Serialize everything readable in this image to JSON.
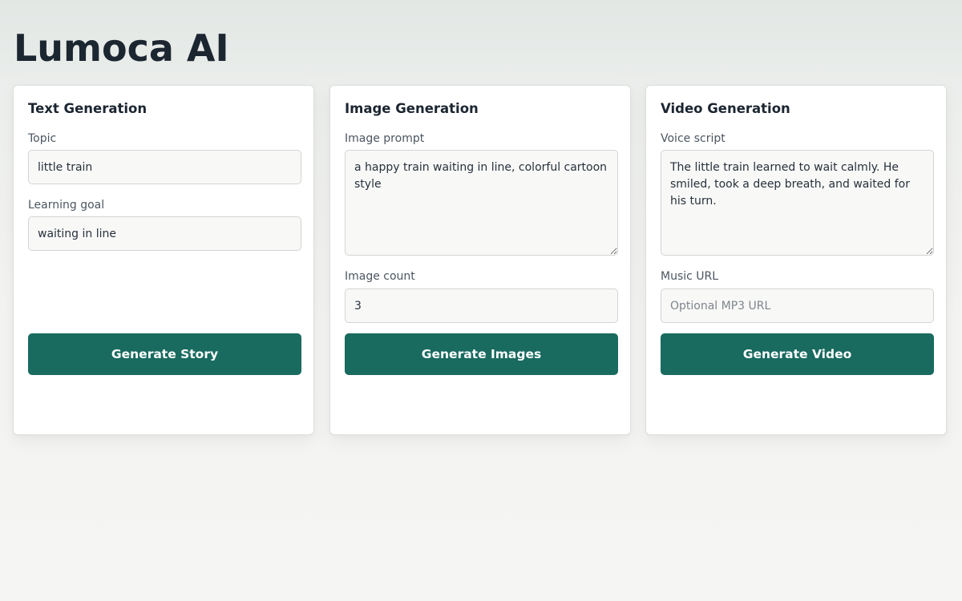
{
  "app": {
    "title": "Lumoca AI"
  },
  "colors": {
    "accent": "#196a5f",
    "card_background": "#ffffff",
    "input_background": "#f8f8f7",
    "page_background": "#f5f5f3"
  },
  "text_generation": {
    "title": "Text Generation",
    "topic_label": "Topic",
    "topic_value": "little train",
    "goal_label": "Learning goal",
    "goal_value": "waiting in line",
    "button_label": "Generate Story"
  },
  "image_generation": {
    "title": "Image Generation",
    "prompt_label": "Image prompt",
    "prompt_value": "a happy train waiting in line, colorful cartoon style",
    "count_label": "Image count",
    "count_value": "3",
    "button_label": "Generate Images"
  },
  "video_generation": {
    "title": "Video Generation",
    "script_label": "Voice script",
    "script_value": "The little train learned to wait calmly. He smiled, took a deep breath, and waited for his turn.",
    "music_label": "Music URL",
    "music_placeholder": "Optional MP3 URL",
    "music_value": "",
    "button_label": "Generate Video"
  }
}
